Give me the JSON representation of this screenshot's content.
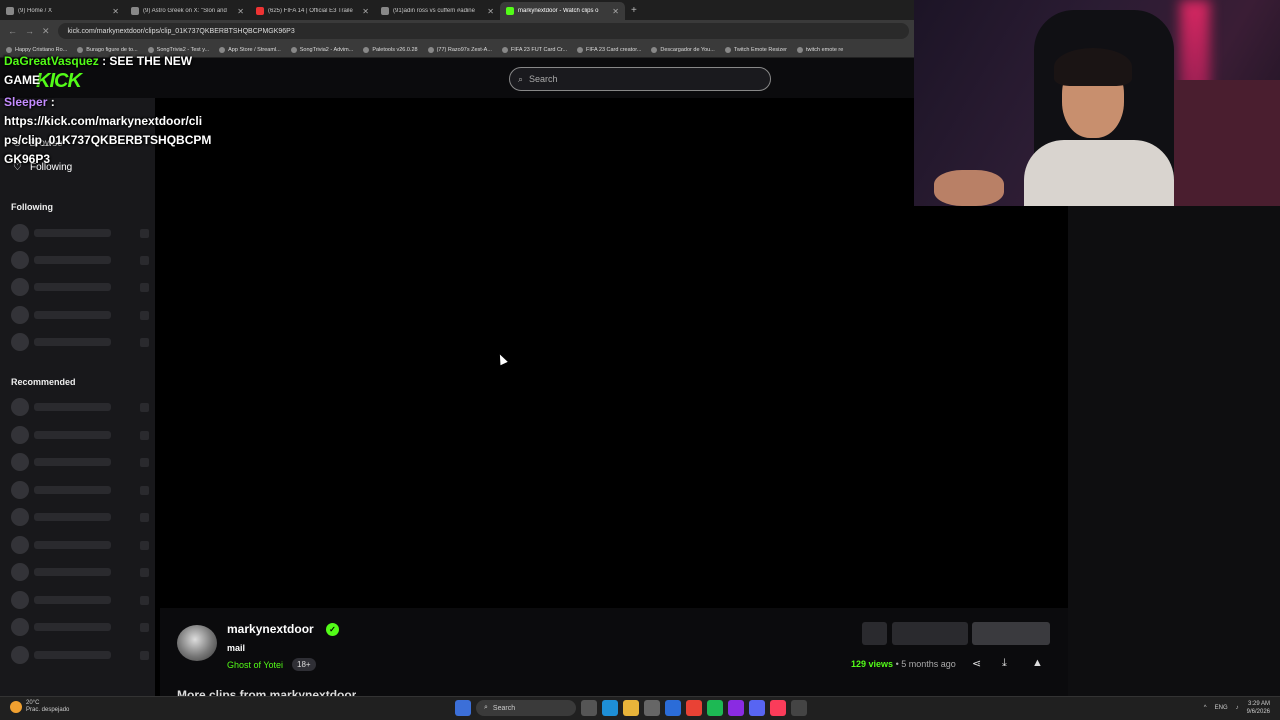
{
  "browser": {
    "tabs": [
      {
        "label": "(9) Home / X",
        "active": false
      },
      {
        "label": "(9) Astro Greek on X: \"Slon and",
        "active": false
      },
      {
        "label": "(625) FIFA 14 | Official E3 Traile",
        "active": false
      },
      {
        "label": "(91)adin ross vs cuffem #adine",
        "active": false
      },
      {
        "label": "markynextdoor - Watch clips o",
        "active": true
      }
    ],
    "new_tab": "+",
    "url": "kick.com/markynextdoor/clips/clip_01K737QKBERBTSHQBCPMGK96P3",
    "bookmarks": [
      "Happy Cristiano Ro...",
      "Burago figure de to...",
      "SongTrivia2 - Test y...",
      "App Store / Streaml...",
      "SongTrivia2 - Advim...",
      "Paletools v26.0.28",
      "(77) Razo97s Zest-A...",
      "FIFA 23 FUT Card Cr...",
      "FIFA 23 Card creator...",
      "Descargador de You...",
      "Twitch Emote Resizer",
      "twitch emote re"
    ]
  },
  "site": {
    "logo": "KICK",
    "search_placeholder": "Search",
    "sidebar": {
      "browse": "Browse",
      "following_nav": "Following",
      "following_header": "Following",
      "recommended_header": "Recommended"
    }
  },
  "clip": {
    "channel": "markynextdoor",
    "title": "mail",
    "category": "Ghost of Yotei",
    "rating": "18+",
    "views": "129 views",
    "age": "• 5 months ago",
    "more_clips": "More clips from markynextdoor"
  },
  "chat_overlay": {
    "user1": "DaGreatVasquez",
    "msg1": ": SEE THE NEW",
    "msg1b": "GAME",
    "user2": "Sleeper",
    "msg2": ":",
    "link_lines": [
      "https://kick.com/markynextdoor/cli",
      "ps/clip_01K737QKBERBTSHQBCPM",
      "GK96P3"
    ]
  },
  "taskbar": {
    "temp": "20°C",
    "weather": "Prac. despejado",
    "search": "Search",
    "lang": "ENG",
    "time": "3:29 AM",
    "date": "9/6/2026"
  },
  "colors": {
    "accent": "#53fc18"
  }
}
